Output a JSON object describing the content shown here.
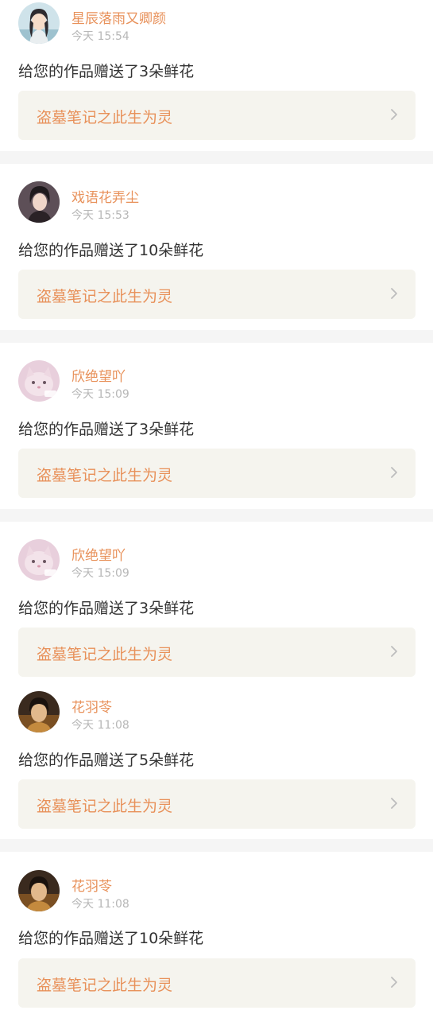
{
  "colors": {
    "accent": "#e8915a",
    "timestamp": "#b7b7b7",
    "text": "#333333",
    "link_bg": "#f5f4ee",
    "divider": "#f5f5f5"
  },
  "notifications": [
    {
      "user": "星辰落雨又卿颜",
      "time": "今天 15:54",
      "message": "给您的作品赠送了3朵鲜花",
      "work_title": "盗墓笔记之此生为灵",
      "avatar_icon": "anime-girl-avatar"
    },
    {
      "user": "戏语花弄尘",
      "time": "今天 15:53",
      "message": "给您的作品赠送了10朵鲜花",
      "work_title": "盗墓笔记之此生为灵",
      "avatar_icon": "dark-haired-character-avatar"
    },
    {
      "user": "欣绝望吖",
      "time": "今天 15:09",
      "message": "给您的作品赠送了3朵鲜花",
      "work_title": "盗墓笔记之此生为灵",
      "avatar_icon": "pink-cat-avatar"
    },
    {
      "user": "欣绝望吖",
      "time": "今天 15:09",
      "message": "给您的作品赠送了3朵鲜花",
      "work_title": "盗墓笔记之此生为灵",
      "avatar_icon": "pink-cat-avatar"
    },
    {
      "user": "花羽苓",
      "time": "今天 11:08",
      "message": "给您的作品赠送了5朵鲜花",
      "work_title": "盗墓笔记之此生为灵",
      "avatar_icon": "portrait-avatar"
    },
    {
      "user": "花羽苓",
      "time": "今天 11:08",
      "message": "给您的作品赠送了10朵鲜花",
      "work_title": "盗墓笔记之此生为灵",
      "avatar_icon": "portrait-avatar"
    }
  ]
}
